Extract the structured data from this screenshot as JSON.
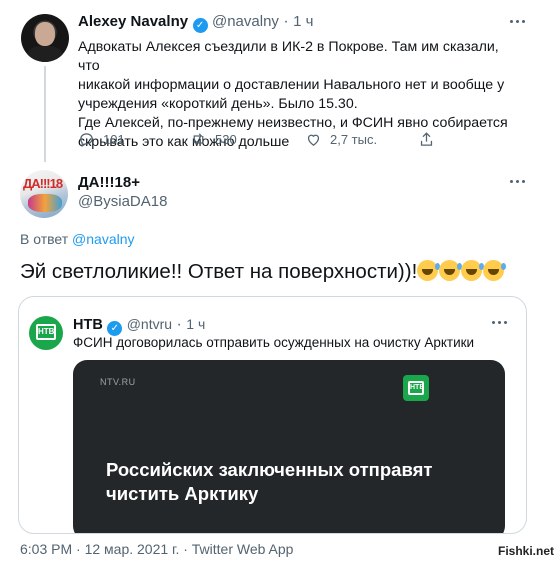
{
  "tweet1": {
    "name": "Alexey Navalny",
    "handle": "@navalny",
    "separator": "·",
    "time": "1 ч",
    "text_lines": [
      "Адвокаты Алексея съездили в ИК-2 в Покрове. Там им сказали, что",
      "никакой информации о доставлении Навального нет и вообще у",
      "учреждения «короткий день». Было 15.30.",
      "Где Алексей, по-прежнему неизвестно, и ФСИН явно собирается",
      "скрывать это как можно дольше"
    ],
    "actions": {
      "replies": "101",
      "retweets": "530",
      "likes": "2,7 тыс."
    }
  },
  "tweet2": {
    "name": "ДА!!!18+",
    "handle": "@BysiaDA18",
    "avatar_text": "ДА!!!18",
    "reply_prefix": "В ответ",
    "reply_handle": "@navalny",
    "text": "Эй светлоликие!! Ответ на поверхности))!"
  },
  "quote": {
    "name": "НТВ",
    "handle": "@ntvru",
    "separator": "·",
    "time": "1 ч",
    "text": "ФСИН договорилась отправить осужденных на очистку Арктики",
    "logo_text": "НТВ",
    "media": {
      "site": "NTV.RU",
      "headline": "Российских заключенных отправят чистить Арктику"
    }
  },
  "footer": {
    "timestamp": "6:03 PM · 12 мар. 2021 г. · Twitter Web App"
  },
  "watermark": "Fishki.net",
  "colors": {
    "accent": "#1d9bf0",
    "ntv_green": "#1aa64a",
    "muted": "#536471"
  }
}
